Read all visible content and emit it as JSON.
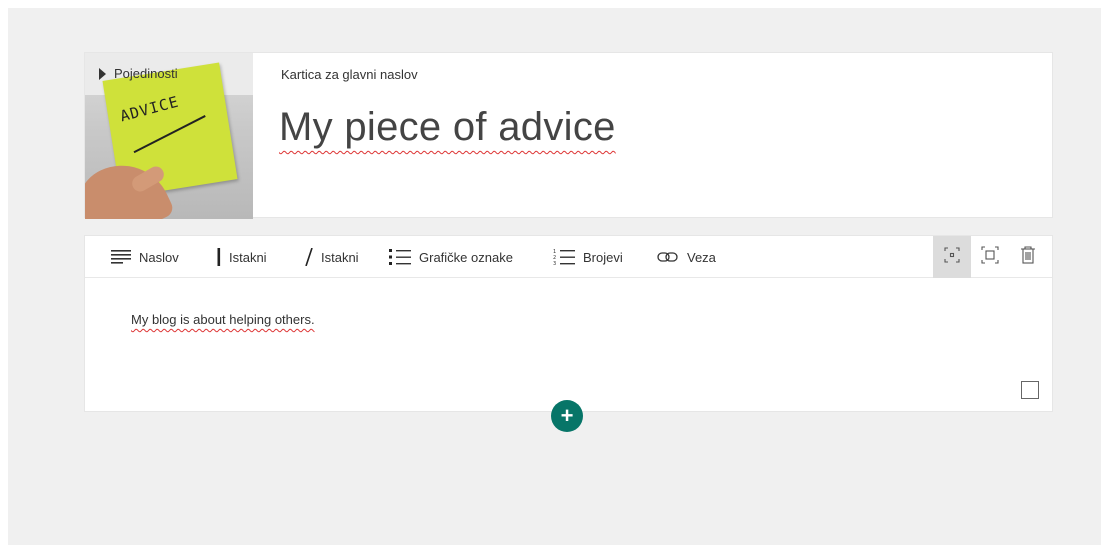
{
  "title_card": {
    "details_label": "Pojedinosti",
    "thumbnail_text": "ADVICE",
    "label": "Kartica za glavni naslov",
    "title": "My piece of advice"
  },
  "toolbar": {
    "items": [
      {
        "label": "Naslov",
        "icon": "heading-icon"
      },
      {
        "label": "Istakni",
        "icon": "bold-icon"
      },
      {
        "label": "Istakni",
        "icon": "italic-icon"
      },
      {
        "label": "Grafičke oznake",
        "icon": "bullets-icon"
      },
      {
        "label": "Brojevi",
        "icon": "numbering-icon"
      },
      {
        "label": "Veza",
        "icon": "link-icon"
      }
    ],
    "right_icons": [
      "focus-small-icon",
      "focus-large-icon",
      "delete-icon"
    ]
  },
  "text_part": {
    "body": "My blog is about helping others."
  },
  "add_button": {
    "label": "+"
  },
  "colors": {
    "accent": "#077568",
    "background": "#f0f0f0",
    "spell_underline": "#dd3333"
  }
}
